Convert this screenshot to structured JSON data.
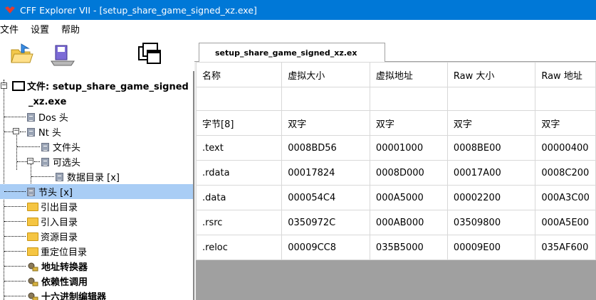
{
  "window": {
    "title": "CFF Explorer VII - [setup_share_game_signed_xz.exe]"
  },
  "menu": [
    "文件",
    "设置",
    "帮助"
  ],
  "toolbar": {
    "icons": [
      "open-file-icon",
      "save-icon",
      "windows-icon"
    ]
  },
  "tab": {
    "label": "setup_share_game_signed_xz.ex"
  },
  "tree": {
    "root_label": "文件: setup_share_game_signed",
    "root_label_cont": "_xz.exe",
    "items": [
      {
        "label": "Dos 头"
      },
      {
        "label": "Nt 头"
      },
      {
        "label": "文件头"
      },
      {
        "label": "可选头"
      },
      {
        "label": "数据目录 [x]"
      },
      {
        "label": "节头 [x]"
      },
      {
        "label": "引出目录"
      },
      {
        "label": "引入目录"
      },
      {
        "label": "资源目录"
      },
      {
        "label": "重定位目录"
      },
      {
        "label": "地址转换器"
      },
      {
        "label": "依赖性调用"
      },
      {
        "label": "十六进制编辑器"
      }
    ]
  },
  "grid": {
    "headers": [
      "名称",
      "虚拟大小",
      "虚拟地址",
      "Raw 大小",
      "Raw 地址"
    ],
    "types": [
      "字节[8]",
      "双字",
      "双字",
      "双字",
      "双字"
    ],
    "rows": [
      [
        ".text",
        "0008BD56",
        "00001000",
        "0008BE00",
        "00000400"
      ],
      [
        ".rdata",
        "00017824",
        "0008D000",
        "00017A00",
        "0008C200"
      ],
      [
        ".data",
        "000054C4",
        "000A5000",
        "00002200",
        "000A3C00"
      ],
      [
        ".rsrc",
        "0350972C",
        "000AB000",
        "03509800",
        "000A5E00"
      ],
      [
        ".reloc",
        "00009CC8",
        "035B5000",
        "00009E00",
        "035AF600"
      ]
    ]
  },
  "colors": {
    "titlebar": "#0078d7",
    "selection": "#a9cdf5"
  }
}
